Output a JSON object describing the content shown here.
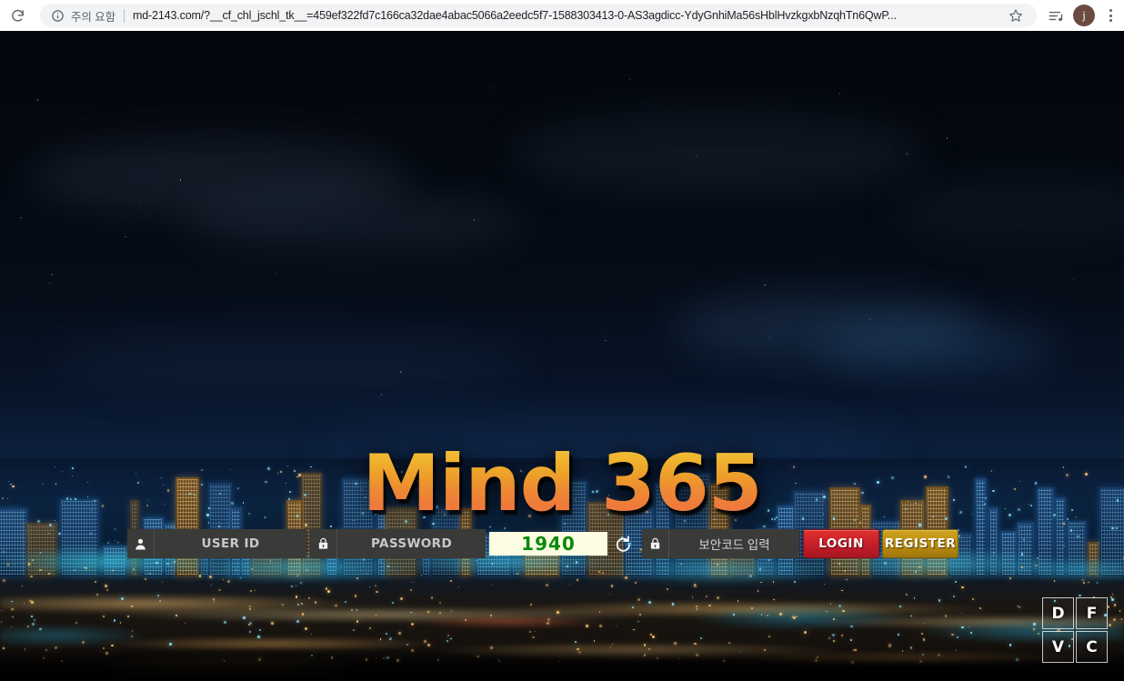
{
  "browser": {
    "reload_icon": "reload-icon",
    "info_icon": "info-circle-icon",
    "security_label": "주의 요함",
    "url": "md-2143.com/?__cf_chl_jschl_tk__=459ef322fd7c166ca32dae4abac5066a2eedc5f7-1588303413-0-AS3agdicc-YdyGnhiMa56sHblHvzkgxbNzqhTn6QwP...",
    "bookmark_icon": "star-icon",
    "media_icon": "playlist-music-icon",
    "avatar_initial": "j",
    "menu_icon": "three-dot-menu-icon"
  },
  "site": {
    "logo_text": "Mind 365",
    "logo_gradient_top": "#f2c23a",
    "logo_gradient_bottom": "#f07a45"
  },
  "form": {
    "userid": {
      "icon": "user-icon",
      "placeholder": "USER ID",
      "value": ""
    },
    "password": {
      "icon": "lock-icon",
      "placeholder": "PASSWORD",
      "value": ""
    },
    "captcha": {
      "code": "1940",
      "text_color": "#0a8a0a",
      "background": "#fdfde3",
      "refresh_icon": "refresh-icon"
    },
    "seccode": {
      "icon": "lock-icon",
      "placeholder": "보안코드 입력",
      "value": ""
    },
    "login_button": {
      "label": "LOGIN",
      "color": "#c51f28"
    },
    "register_button": {
      "label": "REGISTER",
      "color": "#bb8d10"
    },
    "field_background": "#3a3a38"
  },
  "corner_widget": {
    "cells": [
      {
        "label": "D"
      },
      {
        "label": "F"
      },
      {
        "label": "V"
      },
      {
        "label": "C"
      }
    ]
  }
}
